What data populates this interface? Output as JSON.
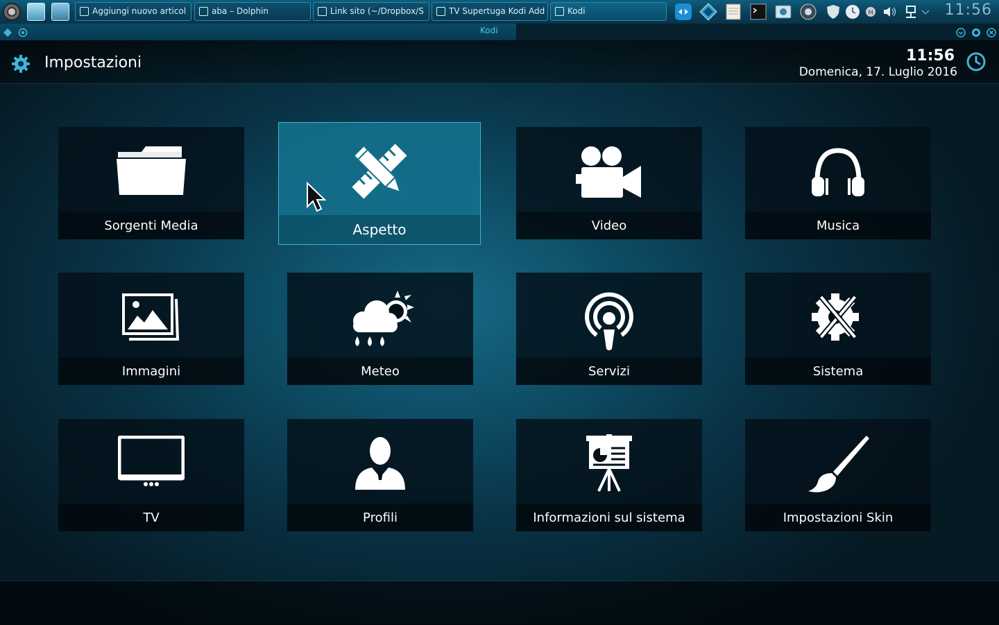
{
  "taskbar": {
    "tasks": [
      {
        "label": "Aggiungi nuovo articol"
      },
      {
        "label": "aba – Dolphin"
      },
      {
        "label": "Link sito (~/Dropbox/S"
      },
      {
        "label": "TV Supertuga Kodi Add"
      },
      {
        "label": "Kodi"
      }
    ],
    "clock": "11:56"
  },
  "window": {
    "title": "Kodi"
  },
  "header": {
    "title": "Impostazioni",
    "time": "11:56",
    "date": "Domenica, 17. Luglio 2016"
  },
  "tiles": [
    {
      "label": "Sorgenti Media",
      "icon": "folder-icon"
    },
    {
      "label": "Aspetto",
      "icon": "pencil-ruler-icon"
    },
    {
      "label": "Video",
      "icon": "video-camera-icon"
    },
    {
      "label": "Musica",
      "icon": "headphones-icon"
    },
    {
      "label": "Immagini",
      "icon": "pictures-icon"
    },
    {
      "label": "Meteo",
      "icon": "weather-icon"
    },
    {
      "label": "Servizi",
      "icon": "podcast-icon"
    },
    {
      "label": "Sistema",
      "icon": "gear-tools-icon"
    },
    {
      "label": "TV",
      "icon": "tv-icon"
    },
    {
      "label": "Profili",
      "icon": "user-icon"
    },
    {
      "label": "Informazioni sul sistema",
      "icon": "presentation-icon"
    },
    {
      "label": "Impostazioni Skin",
      "icon": "paintbrush-icon"
    }
  ],
  "colors": {
    "accent": "#3fb4d8",
    "focus_tile": "#14708c",
    "tile_bg": "#041018"
  }
}
